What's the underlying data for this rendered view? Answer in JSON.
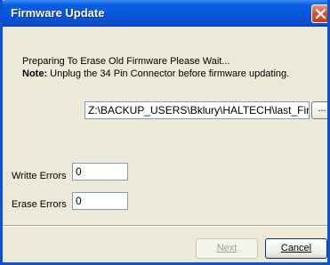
{
  "window": {
    "title": "Firmware Update",
    "close_icon": "close-icon",
    "accent": "#0a53d8"
  },
  "status": {
    "message": "Preparing To Erase Old Firmware Please Wait...",
    "note_label": "Note:",
    "note_text": "Unplug the 34 Pin Connector before firmware updating."
  },
  "file": {
    "path_value": "Z:\\BACKUP_USERS\\Bklury\\HALTECH\\last_Firmwa",
    "browse_label": "..."
  },
  "errors": {
    "write_label": "Writte Errors",
    "write_value": "0",
    "erase_label": "Erase Errors",
    "erase_value": "0"
  },
  "buttons": {
    "next_label": "Next",
    "cancel_label": "Cancel"
  }
}
